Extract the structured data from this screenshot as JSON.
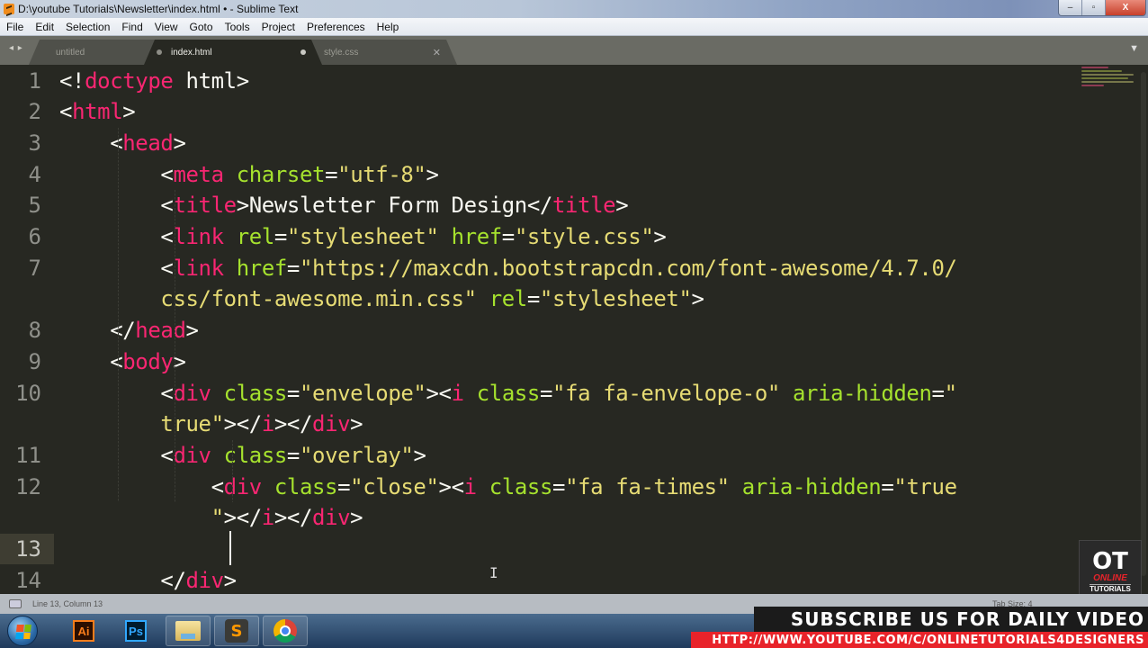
{
  "window": {
    "title": "D:\\youtube Tutorials\\Newsletter\\index.html • - Sublime Text",
    "app_icon": "sublime-text-icon",
    "controls": {
      "minimize": "–",
      "maximize": "▫",
      "close": "X"
    }
  },
  "menu": [
    "File",
    "Edit",
    "Selection",
    "Find",
    "View",
    "Goto",
    "Tools",
    "Project",
    "Preferences",
    "Help"
  ],
  "tabs": [
    {
      "label": "untitled",
      "state": "modified",
      "active": false
    },
    {
      "label": "index.html",
      "state": "modified",
      "active": true
    },
    {
      "label": "style.css",
      "state": "saved",
      "active": false
    }
  ],
  "tab_nav": "◂ ▸",
  "tab_menu": "▼",
  "editor": {
    "language": "HTML",
    "theme_colors": {
      "background": "#272822",
      "tag": "#f92672",
      "attribute": "#a6e22e",
      "string": "#e6db74",
      "text": "#f8f8f2"
    },
    "current_line": 13,
    "line_numbers": [
      "1",
      "2",
      "3",
      "4",
      "5",
      "6",
      "7",
      "8",
      "9",
      "10",
      "11",
      "12",
      "13",
      "14"
    ],
    "lines": [
      {
        "num": "1",
        "tokens": [
          [
            "p",
            "<!"
          ],
          [
            "t",
            "doctype"
          ],
          [
            "p",
            " html>"
          ]
        ]
      },
      {
        "num": "2",
        "tokens": [
          [
            "p",
            "<"
          ],
          [
            "t",
            "html"
          ],
          [
            "p",
            ">"
          ]
        ]
      },
      {
        "num": "3",
        "tokens": [
          [
            "p",
            "    <"
          ],
          [
            "t",
            "head"
          ],
          [
            "p",
            ">"
          ]
        ]
      },
      {
        "num": "4",
        "tokens": [
          [
            "p",
            "        <"
          ],
          [
            "t",
            "meta"
          ],
          [
            "p",
            " "
          ],
          [
            "a",
            "charset"
          ],
          [
            "p",
            "="
          ],
          [
            "s",
            "\"utf-8\""
          ],
          [
            "p",
            ">"
          ]
        ]
      },
      {
        "num": "5",
        "tokens": [
          [
            "p",
            "        <"
          ],
          [
            "t",
            "title"
          ],
          [
            "p",
            ">Newsletter Form Design</"
          ],
          [
            "t",
            "title"
          ],
          [
            "p",
            ">"
          ]
        ]
      },
      {
        "num": "6",
        "tokens": [
          [
            "p",
            "        <"
          ],
          [
            "t",
            "link"
          ],
          [
            "p",
            " "
          ],
          [
            "a",
            "rel"
          ],
          [
            "p",
            "="
          ],
          [
            "s",
            "\"stylesheet\""
          ],
          [
            "p",
            " "
          ],
          [
            "a",
            "href"
          ],
          [
            "p",
            "="
          ],
          [
            "s",
            "\"style.css\""
          ],
          [
            "p",
            ">"
          ]
        ]
      },
      {
        "num": "7",
        "tokens": [
          [
            "p",
            "        <"
          ],
          [
            "t",
            "link"
          ],
          [
            "p",
            " "
          ],
          [
            "a",
            "href"
          ],
          [
            "p",
            "="
          ],
          [
            "s",
            "\"https://maxcdn.bootstrapcdn.com/font-awesome/4.7.0/"
          ]
        ]
      },
      {
        "num": "",
        "tokens": [
          [
            "s",
            "        css/font-awesome.min.css\""
          ],
          [
            "p",
            " "
          ],
          [
            "a",
            "rel"
          ],
          [
            "p",
            "="
          ],
          [
            "s",
            "\"stylesheet\""
          ],
          [
            "p",
            ">"
          ]
        ]
      },
      {
        "num": "8",
        "tokens": [
          [
            "p",
            "    </"
          ],
          [
            "t",
            "head"
          ],
          [
            "p",
            ">"
          ]
        ]
      },
      {
        "num": "9",
        "tokens": [
          [
            "p",
            "    <"
          ],
          [
            "t",
            "body"
          ],
          [
            "p",
            ">"
          ]
        ]
      },
      {
        "num": "10",
        "tokens": [
          [
            "p",
            "        <"
          ],
          [
            "t",
            "div"
          ],
          [
            "p",
            " "
          ],
          [
            "a",
            "class"
          ],
          [
            "p",
            "="
          ],
          [
            "s",
            "\"envelope\""
          ],
          [
            "p",
            "><"
          ],
          [
            "t",
            "i"
          ],
          [
            "p",
            " "
          ],
          [
            "a",
            "class"
          ],
          [
            "p",
            "="
          ],
          [
            "s",
            "\"fa fa-envelope-o\""
          ],
          [
            "p",
            " "
          ],
          [
            "a",
            "aria-hidden"
          ],
          [
            "p",
            "="
          ],
          [
            "s",
            "\""
          ]
        ]
      },
      {
        "num": "",
        "tokens": [
          [
            "s",
            "        true\""
          ],
          [
            "p",
            "></"
          ],
          [
            "t",
            "i"
          ],
          [
            "p",
            "></"
          ],
          [
            "t",
            "div"
          ],
          [
            "p",
            ">"
          ]
        ]
      },
      {
        "num": "11",
        "tokens": [
          [
            "p",
            "        <"
          ],
          [
            "t",
            "div"
          ],
          [
            "p",
            " "
          ],
          [
            "a",
            "class"
          ],
          [
            "p",
            "="
          ],
          [
            "s",
            "\"overlay\""
          ],
          [
            "p",
            ">"
          ]
        ]
      },
      {
        "num": "12",
        "tokens": [
          [
            "p",
            "            <"
          ],
          [
            "t",
            "div"
          ],
          [
            "p",
            " "
          ],
          [
            "a",
            "class"
          ],
          [
            "p",
            "="
          ],
          [
            "s",
            "\"close\""
          ],
          [
            "p",
            "><"
          ],
          [
            "t",
            "i"
          ],
          [
            "p",
            " "
          ],
          [
            "a",
            "class"
          ],
          [
            "p",
            "="
          ],
          [
            "s",
            "\"fa fa-times\""
          ],
          [
            "p",
            " "
          ],
          [
            "a",
            "aria-hidden"
          ],
          [
            "p",
            "="
          ],
          [
            "s",
            "\"true"
          ]
        ]
      },
      {
        "num": "",
        "tokens": [
          [
            "s",
            "            \""
          ],
          [
            "p",
            "></"
          ],
          [
            "t",
            "i"
          ],
          [
            "p",
            "></"
          ],
          [
            "t",
            "div"
          ],
          [
            "p",
            ">"
          ]
        ]
      },
      {
        "num": "13",
        "tokens": [
          [
            "p",
            ""
          ]
        ]
      },
      {
        "num": "14",
        "tokens": [
          [
            "p",
            "        </"
          ],
          [
            "t",
            "div"
          ],
          [
            "p",
            ">"
          ]
        ]
      }
    ]
  },
  "statusbar": {
    "position": "Line 13, Column 13",
    "tab_size": "Tab Size: 4"
  },
  "taskbar": {
    "start": "start-button",
    "apps": [
      {
        "name": "Adobe Illustrator",
        "label": "Ai"
      },
      {
        "name": "Adobe Photoshop",
        "label": "Ps"
      },
      {
        "name": "Windows Explorer",
        "label": ""
      },
      {
        "name": "Sublime Text",
        "label": "S"
      },
      {
        "name": "Google Chrome",
        "label": ""
      }
    ]
  },
  "overlay": {
    "logo_mark": "OT",
    "logo_online": "ONLINE",
    "logo_tutorials": "TUTORIALS",
    "subscribe": "SUBSCRIBE US FOR DAILY VIDEO",
    "url": "HTTP://WWW.YOUTUBE.COM/C/ONLINETUTORIALS4DESIGNERS",
    "accent": "#e8232a"
  }
}
